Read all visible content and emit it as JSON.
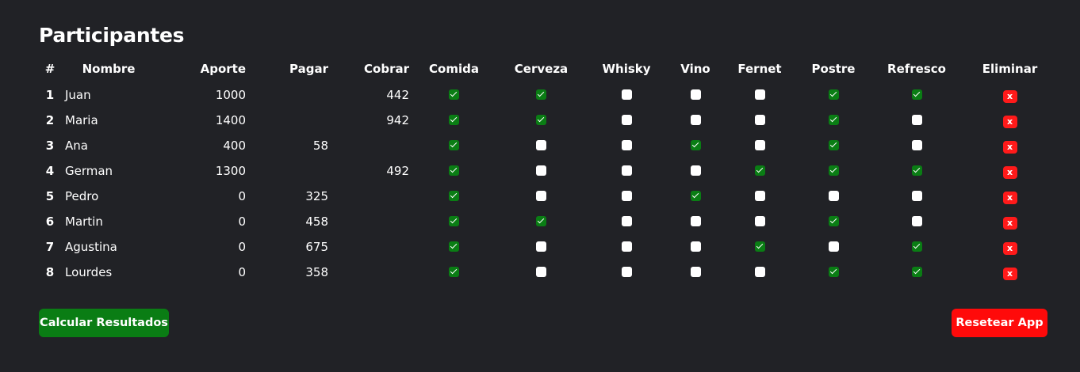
{
  "page": {
    "title": "Participantes"
  },
  "table": {
    "headers": {
      "index": "#",
      "name": "Nombre",
      "aporte": "Aporte",
      "pagar": "Pagar",
      "cobrar": "Cobrar",
      "comida": "Comida",
      "cerveza": "Cerveza",
      "whisky": "Whisky",
      "vino": "Vino",
      "fernet": "Fernet",
      "postre": "Postre",
      "refresco": "Refresco",
      "eliminar": "Eliminar"
    },
    "rows": [
      {
        "index": "1",
        "name": "Juan",
        "aporte": "1000",
        "pagar": "",
        "cobrar": "442",
        "comida": true,
        "cerveza": true,
        "whisky": false,
        "vino": false,
        "fernet": false,
        "postre": true,
        "refresco": true,
        "delete_label": "x"
      },
      {
        "index": "2",
        "name": "Maria",
        "aporte": "1400",
        "pagar": "",
        "cobrar": "942",
        "comida": true,
        "cerveza": true,
        "whisky": false,
        "vino": false,
        "fernet": false,
        "postre": true,
        "refresco": false,
        "delete_label": "x"
      },
      {
        "index": "3",
        "name": "Ana",
        "aporte": "400",
        "pagar": "58",
        "cobrar": "",
        "comida": true,
        "cerveza": false,
        "whisky": false,
        "vino": true,
        "fernet": false,
        "postre": true,
        "refresco": false,
        "delete_label": "x"
      },
      {
        "index": "4",
        "name": "German",
        "aporte": "1300",
        "pagar": "",
        "cobrar": "492",
        "comida": true,
        "cerveza": false,
        "whisky": false,
        "vino": false,
        "fernet": true,
        "postre": true,
        "refresco": true,
        "delete_label": "x"
      },
      {
        "index": "5",
        "name": "Pedro",
        "aporte": "0",
        "pagar": "325",
        "cobrar": "",
        "comida": true,
        "cerveza": false,
        "whisky": false,
        "vino": true,
        "fernet": false,
        "postre": false,
        "refresco": false,
        "delete_label": "x"
      },
      {
        "index": "6",
        "name": "Martin",
        "aporte": "0",
        "pagar": "458",
        "cobrar": "",
        "comida": true,
        "cerveza": true,
        "whisky": false,
        "vino": false,
        "fernet": false,
        "postre": true,
        "refresco": false,
        "delete_label": "x"
      },
      {
        "index": "7",
        "name": "Agustina",
        "aporte": "0",
        "pagar": "675",
        "cobrar": "",
        "comida": true,
        "cerveza": false,
        "whisky": false,
        "vino": false,
        "fernet": true,
        "postre": false,
        "refresco": true,
        "delete_label": "x"
      },
      {
        "index": "8",
        "name": "Lourdes",
        "aporte": "0",
        "pagar": "358",
        "cobrar": "",
        "comida": true,
        "cerveza": false,
        "whisky": false,
        "vino": false,
        "fernet": false,
        "postre": true,
        "refresco": true,
        "delete_label": "x"
      }
    ]
  },
  "actions": {
    "calculate_label": "Calcular Resultados",
    "reset_label": "Resetear App"
  },
  "colors": {
    "background": "#212226",
    "checked": "#0a7d14",
    "delete": "#ff1a1a",
    "calculate": "#0a7d14",
    "reset": "#ff0a0a"
  }
}
